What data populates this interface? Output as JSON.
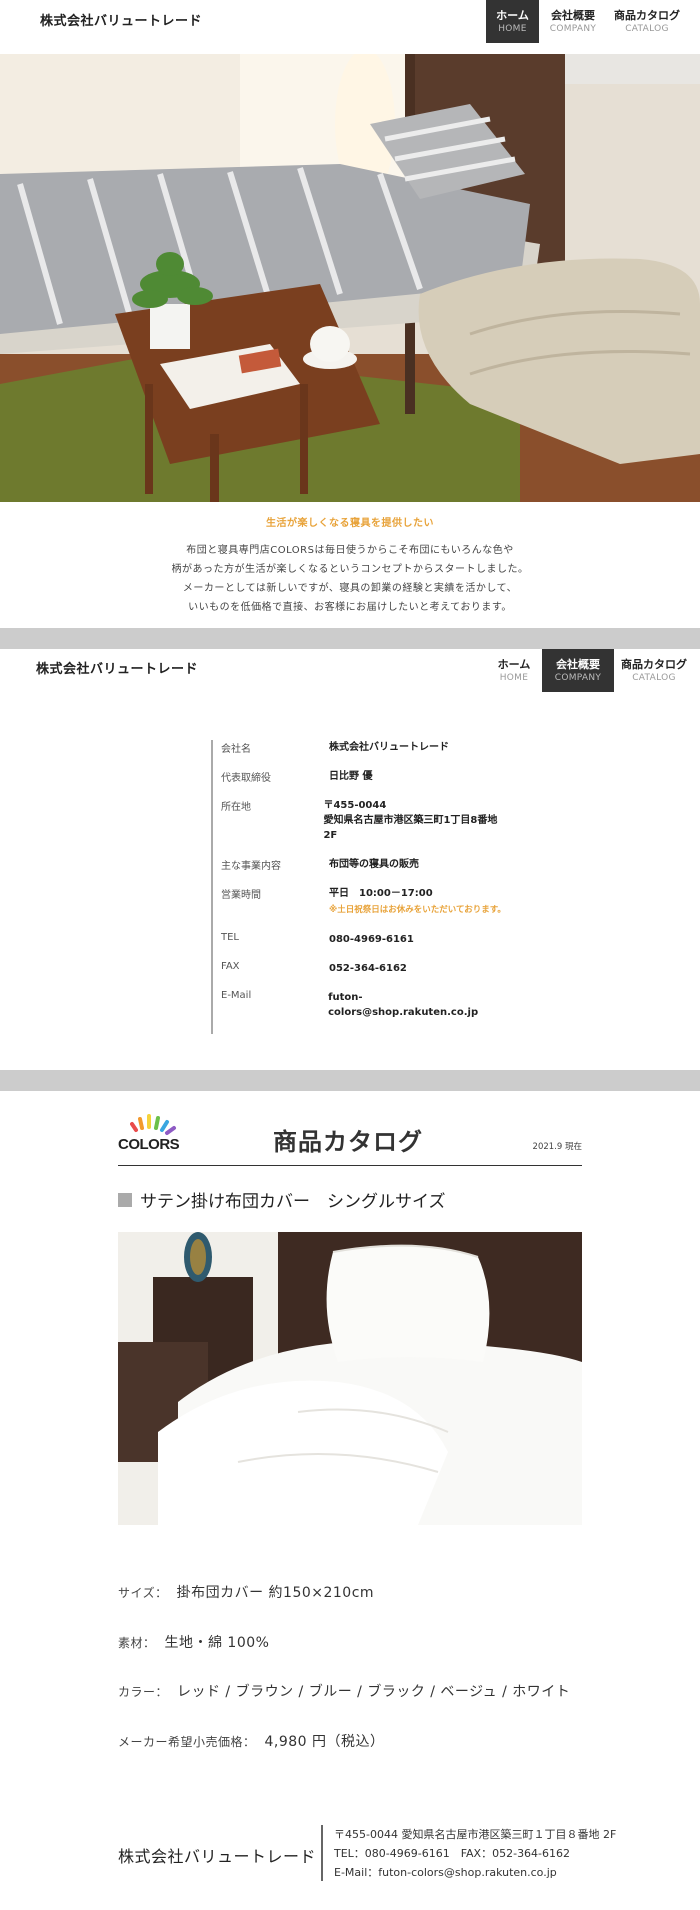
{
  "header": {
    "logo": "株式会社バリュートレード",
    "nav": [
      {
        "jp": "ホーム",
        "en": "HOME"
      },
      {
        "jp": "会社概要",
        "en": "COMPANY"
      },
      {
        "jp": "商品カタログ",
        "en": "CATALOG"
      }
    ]
  },
  "intro": {
    "tagline": "生活が楽しくなる寝具を提供したい",
    "lines": [
      "布団と寝具専門店COLORSは毎日使うからこそ布団にもいろんな色や",
      "柄があった方が生活が楽しくなるというコンセプトからスタートしました。",
      "メーカーとしては新しいですが、寝具の卸業の経験と実績を活かして、",
      "いいものを低価格で直接、お客様にお届けしたいと考えております。"
    ]
  },
  "company": {
    "rows": [
      {
        "k": "会社名",
        "v": "株式会社バリュートレード"
      },
      {
        "k": "代表取締役",
        "v": "日比野 優"
      },
      {
        "k": "所在地",
        "v": "〒455-0044",
        "v2": "愛知県名古屋市港区築三町1丁目8番地　2F"
      },
      {
        "k": "主な事業内容",
        "v": "布団等の寝具の販売"
      },
      {
        "k": "営業時間",
        "v": "平日　10:00－17:00",
        "note": "※土日祝祭日はお休みをいただいております。"
      },
      {
        "k": "TEL",
        "v": "080-4969-6161"
      },
      {
        "k": "FAX",
        "v": "052-364-6162"
      },
      {
        "k": "E-Mail",
        "v": "futon-colors@shop.rakuten.co.jp"
      }
    ]
  },
  "catalog": {
    "brand": "COLORS",
    "title": "商品カタログ",
    "date": "2021.9 現在",
    "product_title": "サテン掛け布団カバー　シングルサイズ",
    "specs": [
      {
        "label": "サイズ：",
        "value": "掛布団カバー 約150×210cm"
      },
      {
        "label": "素材：",
        "value": "生地・綿 100%"
      },
      {
        "label": "カラー：",
        "value": "レッド / ブラウン / ブルー / ブラック / ベージュ / ホワイト"
      },
      {
        "label": "メーカー希望小売価格：",
        "value": "4,980 円（税込）"
      }
    ]
  },
  "footer": {
    "name": "株式会社バリュートレード",
    "lines": [
      "〒455-0044 愛知県名古屋市港区築三町１丁目８番地 2F",
      "TEL：080-4969-6161　FAX：052-364-6162",
      "E-Mail：futon-colors@shop.rakuten.co.jp"
    ]
  },
  "colors": {
    "accent": "#e8a33a",
    "nav_active": "#333333",
    "separator": "#cccccc"
  }
}
